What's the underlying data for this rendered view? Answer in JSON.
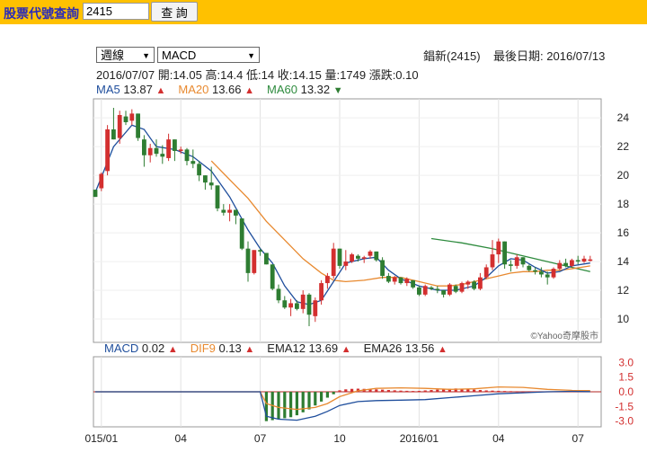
{
  "toolbar": {
    "query_label": "股票代號查詢",
    "stock_code": "2415",
    "search_button": "查 詢"
  },
  "selectors": {
    "period": "週線",
    "indicator": "MACD"
  },
  "header": {
    "stock_name": "錩新(2415)",
    "last_date_label": "最後日期: 2016/07/13"
  },
  "ohlc": {
    "date": "2016/07/07",
    "open": "開:14.05",
    "high": "高:14.4",
    "low": "低:14",
    "close": "收:14.15",
    "volume": "量:1749",
    "change": "漲跌:0.10"
  },
  "ma_legend": [
    {
      "label": "MA5",
      "value": "13.87",
      "trend": "up",
      "color": "#1f4e9c"
    },
    {
      "label": "MA20",
      "value": "13.66",
      "trend": "up",
      "color": "#e8892f"
    },
    {
      "label": "MA60",
      "value": "13.32",
      "trend": "down",
      "color": "#2e8b3e"
    }
  ],
  "macd_legend": [
    {
      "label": "MACD",
      "value": "0.02",
      "trend": "up",
      "color": "#1f4e9c"
    },
    {
      "label": "DIF9",
      "value": "0.13",
      "trend": "up",
      "color": "#e8892f"
    },
    {
      "label": "EMA12",
      "value": "13.69",
      "trend": "up",
      "color": "#222222"
    },
    {
      "label": "EMA26",
      "value": "13.56",
      "trend": "up",
      "color": "#222222"
    }
  ],
  "watermark": "©Yahoo奇摩股市",
  "colors": {
    "up": "#d32f2f",
    "down": "#2e7d32",
    "topbar": "#ffc100"
  },
  "chart_data": {
    "type": "candlestick",
    "price_axis": {
      "ticks": [
        24,
        22,
        20,
        18,
        16,
        14,
        12,
        10
      ],
      "range": [
        8.5,
        25.2
      ]
    },
    "macd_axis": {
      "ticks": [
        "3.0",
        "1.5",
        "0.0",
        "-1.5",
        "-3.0"
      ],
      "range": [
        -3.4,
        3.4
      ]
    },
    "x_ticks": [
      {
        "label": "015/01",
        "i": 1
      },
      {
        "label": "04",
        "i": 14
      },
      {
        "label": "07",
        "i": 27
      },
      {
        "label": "10",
        "i": 40
      },
      {
        "label": "2016/01",
        "i": 53
      },
      {
        "label": "04",
        "i": 66
      },
      {
        "label": "07",
        "i": 79
      }
    ],
    "candles": [
      [
        19,
        19,
        18.5,
        18.5
      ],
      [
        19.1,
        20.2,
        18.9,
        20.1
      ],
      [
        20.3,
        23.5,
        20,
        23.2
      ],
      [
        23.2,
        24.7,
        22.5,
        22.5
      ],
      [
        22.6,
        24.5,
        22.2,
        24.2
      ],
      [
        24.1,
        24.5,
        23.5,
        23.7
      ],
      [
        23.8,
        24.6,
        23.5,
        24.3
      ],
      [
        24.3,
        24.3,
        22.4,
        22.6
      ],
      [
        22.5,
        22.8,
        20.6,
        21.4
      ],
      [
        21.4,
        22.2,
        20.9,
        21.9
      ],
      [
        21.9,
        22.5,
        21.3,
        21.5
      ],
      [
        21.5,
        22.1,
        20.8,
        21.3
      ],
      [
        21.2,
        22.9,
        21,
        22.5
      ],
      [
        22.5,
        22.5,
        21,
        21.7
      ],
      [
        21.7,
        22,
        21.5,
        21.8
      ],
      [
        21.8,
        21.9,
        20.7,
        21
      ],
      [
        21,
        21.8,
        20.5,
        20.8
      ],
      [
        20.8,
        21,
        19.6,
        20
      ],
      [
        20,
        20,
        19,
        19.5
      ],
      [
        19.5,
        20.6,
        19,
        19.3
      ],
      [
        19.3,
        19.3,
        17.5,
        17.7
      ],
      [
        17.6,
        18,
        17.2,
        17.4
      ],
      [
        17.4,
        18,
        16.8,
        17.6
      ],
      [
        17.6,
        17.6,
        16.6,
        17.2
      ],
      [
        17,
        17,
        14.8,
        14.9
      ],
      [
        14.9,
        15.4,
        12.6,
        13.2
      ],
      [
        13.2,
        14.8,
        13.1,
        14.8
      ],
      [
        14.8,
        14.9,
        14.4,
        14.7
      ],
      [
        14.6,
        14.6,
        13.8,
        13.8
      ],
      [
        13.8,
        13.8,
        12,
        12.1
      ],
      [
        12.1,
        12.4,
        11.1,
        11.3
      ],
      [
        11.3,
        11.6,
        10.7,
        10.8
      ],
      [
        10.8,
        11.4,
        10.2,
        11.1
      ],
      [
        11.1,
        11.3,
        10.6,
        10.7
      ],
      [
        10.7,
        12,
        10.4,
        11.7
      ],
      [
        11.7,
        11.8,
        9.5,
        10.3
      ],
      [
        10.2,
        11.5,
        9.8,
        11.3
      ],
      [
        11.3,
        12.7,
        11,
        12.5
      ],
      [
        12.5,
        13.2,
        12.1,
        13
      ],
      [
        13,
        15.3,
        12.8,
        14.9
      ],
      [
        14.9,
        14.9,
        13.5,
        13.7
      ],
      [
        13.7,
        14.8,
        13.4,
        14
      ],
      [
        14,
        14.6,
        13.9,
        14.5
      ],
      [
        14.4,
        14.5,
        14,
        14.2
      ],
      [
        14.2,
        14.4,
        13.9,
        14.3
      ],
      [
        14.4,
        14.8,
        14.2,
        14.7
      ],
      [
        14.7,
        14.7,
        14,
        14.1
      ],
      [
        14.1,
        14.3,
        12.8,
        13
      ],
      [
        13,
        13.2,
        12.5,
        12.6
      ],
      [
        12.6,
        13,
        12.4,
        12.9
      ],
      [
        12.9,
        12.9,
        12.4,
        12.5
      ],
      [
        12.5,
        12.9,
        12.3,
        12.8
      ],
      [
        12.7,
        12.7,
        12.1,
        12.2
      ],
      [
        12.2,
        12.3,
        11.6,
        11.7
      ],
      [
        11.7,
        12.4,
        11.6,
        12.3
      ],
      [
        12.2,
        12.3,
        12,
        12.1
      ],
      [
        12.1,
        12.3,
        11.8,
        12
      ],
      [
        12,
        12,
        11.5,
        11.7
      ],
      [
        11.7,
        12.5,
        11.6,
        12.4
      ],
      [
        12.3,
        12.4,
        11.8,
        11.9
      ],
      [
        11.9,
        12.6,
        11.8,
        12.5
      ],
      [
        12.4,
        12.7,
        12.1,
        12.6
      ],
      [
        12.6,
        12.7,
        12,
        12.1
      ],
      [
        12.1,
        13.2,
        12,
        12.9
      ],
      [
        12.9,
        13.8,
        12.8,
        13.6
      ],
      [
        13.6,
        15.5,
        13.4,
        14.5
      ],
      [
        14.5,
        15.6,
        13.9,
        15.4
      ],
      [
        15.4,
        15.4,
        13.5,
        13.8
      ],
      [
        13.8,
        14.1,
        13.3,
        13.7
      ],
      [
        13.7,
        14.5,
        13.5,
        14.3
      ],
      [
        14.3,
        14.3,
        13.6,
        13.8
      ],
      [
        13.7,
        13.8,
        13.3,
        13.4
      ],
      [
        13.4,
        13.6,
        13.1,
        13.3
      ],
      [
        13.3,
        13.6,
        12.9,
        13.1
      ],
      [
        13.1,
        13.3,
        12.4,
        12.9
      ],
      [
        12.9,
        13.6,
        12.8,
        13.5
      ],
      [
        13.5,
        14.1,
        13.4,
        13.9
      ],
      [
        13.9,
        14.2,
        13.6,
        13.7
      ],
      [
        13.7,
        14.2,
        13.6,
        14.1
      ],
      [
        14.1,
        14.4,
        13.8,
        14
      ],
      [
        14,
        14.4,
        13.9,
        14.2
      ],
      [
        14.05,
        14.4,
        14,
        14.15
      ]
    ],
    "ma5": [
      [
        0,
        18.8
      ],
      [
        3,
        22
      ],
      [
        6,
        23.5
      ],
      [
        8,
        23.2
      ],
      [
        10,
        22
      ],
      [
        13,
        21.8
      ],
      [
        16,
        21.3
      ],
      [
        19,
        20.3
      ],
      [
        22,
        18.5
      ],
      [
        25,
        16.2
      ],
      [
        27,
        14.9
      ],
      [
        29,
        13.9
      ],
      [
        31,
        12.3
      ],
      [
        33,
        11.2
      ],
      [
        35,
        11
      ],
      [
        37,
        11.3
      ],
      [
        39,
        12.6
      ],
      [
        41,
        13.9
      ],
      [
        44,
        14.2
      ],
      [
        46,
        14.3
      ],
      [
        48,
        13.4
      ],
      [
        50,
        12.8
      ],
      [
        53,
        12.3
      ],
      [
        56,
        12
      ],
      [
        59,
        12
      ],
      [
        62,
        12.3
      ],
      [
        64,
        12.9
      ],
      [
        66,
        13.7
      ],
      [
        68,
        14.2
      ],
      [
        70,
        14.1
      ],
      [
        72,
        13.6
      ],
      [
        74,
        13.2
      ],
      [
        76,
        13.3
      ],
      [
        78,
        13.7
      ],
      [
        81,
        13.9
      ]
    ],
    "ma20": [
      [
        19,
        21
      ],
      [
        22,
        19.7
      ],
      [
        25,
        18.4
      ],
      [
        28,
        16.8
      ],
      [
        31,
        15.5
      ],
      [
        34,
        14.2
      ],
      [
        37,
        13.2
      ],
      [
        39,
        12.7
      ],
      [
        41,
        12.6
      ],
      [
        44,
        12.7
      ],
      [
        47,
        12.9
      ],
      [
        50,
        12.9
      ],
      [
        53,
        12.6
      ],
      [
        56,
        12.3
      ],
      [
        58,
        12.3
      ],
      [
        60,
        12.4
      ],
      [
        62,
        12.6
      ],
      [
        64,
        12.8
      ],
      [
        66,
        13
      ],
      [
        68,
        13.2
      ],
      [
        70,
        13.3
      ],
      [
        72,
        13.3
      ],
      [
        74,
        13.4
      ],
      [
        76,
        13.4
      ],
      [
        78,
        13.5
      ],
      [
        81,
        13.7
      ]
    ],
    "ma60": [
      [
        55,
        15.6
      ],
      [
        60,
        15.3
      ],
      [
        65,
        14.9
      ],
      [
        70,
        14.4
      ],
      [
        75,
        13.9
      ],
      [
        79,
        13.5
      ],
      [
        81,
        13.3
      ]
    ],
    "macd_line": [
      [
        0,
        0
      ],
      [
        27,
        0
      ],
      [
        28,
        -2.5
      ],
      [
        30,
        -2.8
      ],
      [
        33,
        -2.9
      ],
      [
        36,
        -2.5
      ],
      [
        38,
        -2
      ],
      [
        40,
        -1.4
      ],
      [
        43,
        -1
      ],
      [
        46,
        -0.9
      ],
      [
        50,
        -0.85
      ],
      [
        54,
        -0.8
      ],
      [
        58,
        -0.6
      ],
      [
        62,
        -0.4
      ],
      [
        66,
        -0.2
      ],
      [
        70,
        -0.1
      ],
      [
        74,
        0
      ],
      [
        78,
        0.05
      ],
      [
        81,
        0.02
      ]
    ],
    "dif9_line": [
      [
        0,
        0
      ],
      [
        27,
        0
      ],
      [
        28,
        -1.2
      ],
      [
        30,
        -1.6
      ],
      [
        33,
        -1.8
      ],
      [
        36,
        -1.6
      ],
      [
        38,
        -1.2
      ],
      [
        40,
        -0.5
      ],
      [
        43,
        0.1
      ],
      [
        46,
        0.35
      ],
      [
        50,
        0.4
      ],
      [
        54,
        0.35
      ],
      [
        58,
        0.25
      ],
      [
        62,
        0.3
      ],
      [
        66,
        0.5
      ],
      [
        70,
        0.45
      ],
      [
        74,
        0.25
      ],
      [
        78,
        0.15
      ],
      [
        81,
        0.13
      ]
    ],
    "macd_hist": [
      -3,
      -2.9,
      -2.8,
      -2.7,
      -2.6,
      -2.4,
      -2.1,
      -1.8,
      -1.4,
      -1,
      -0.6,
      -0.25,
      0.15,
      0.25,
      0.3,
      0.32,
      0.3,
      0.28,
      0.25,
      0.22,
      0.18,
      0.15,
      0.12,
      0.1,
      0.08,
      0.1,
      0.14,
      0.18,
      0.22,
      0.26,
      0.3,
      0.34,
      0.3,
      0.26,
      0.22,
      0.18,
      0.14,
      0.12,
      0.1,
      0.08,
      0.06,
      0.04,
      0.02,
      0.02
    ],
    "macd_hist_start": 28
  }
}
